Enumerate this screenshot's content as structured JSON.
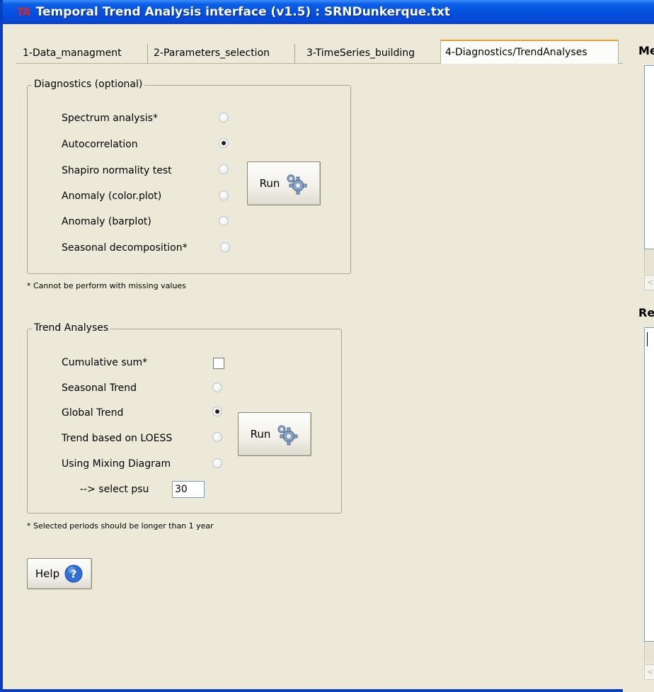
{
  "window": {
    "app_icon": "TA",
    "title": "Temporal Trend Analysis interface (v1.5) : SRNDunkerque.txt"
  },
  "tabs": [
    {
      "label": "1-Data_managment",
      "selected": false
    },
    {
      "label": "2-Parameters_selection",
      "selected": false
    },
    {
      "label": "3-TimeSeries_building",
      "selected": false
    },
    {
      "label": "4-Diagnostics/TrendAnalyses",
      "selected": true
    }
  ],
  "diagnostics": {
    "legend": "Diagnostics (optional)",
    "options": [
      {
        "label": "Spectrum analysis*",
        "checked": false
      },
      {
        "label": "Autocorrelation",
        "checked": true
      },
      {
        "label": "Shapiro normality test",
        "checked": false
      },
      {
        "label": "Anomaly (color.plot)",
        "checked": false
      },
      {
        "label": "Anomaly (barplot)",
        "checked": false
      },
      {
        "label": "Seasonal decomposition*",
        "checked": false
      }
    ],
    "run_label": "Run",
    "note": "* Cannot be perform with missing values"
  },
  "trend": {
    "legend": "Trend Analyses",
    "cumulative_label": "Cumulative sum*",
    "cumulative_checked": false,
    "options": [
      {
        "label": "Seasonal Trend",
        "checked": false
      },
      {
        "label": "Global Trend",
        "checked": true
      },
      {
        "label": "Trend based on LOESS",
        "checked": false
      },
      {
        "label": "Using Mixing Diagram",
        "checked": false
      }
    ],
    "psu_label": "--> select psu",
    "psu_value": "30",
    "run_label": "Run",
    "note": "* Selected periods should be longer than 1 year"
  },
  "help": {
    "label": "Help"
  },
  "right_panel": {
    "top_label": "Me",
    "bottom_label": "Re"
  },
  "icons": {
    "run": "gear-icon",
    "help": "help-icon"
  },
  "colors": {
    "titlebar": "#0451e0",
    "selected_tab_accent": "#e3a32b",
    "background": "#ece9d8"
  }
}
